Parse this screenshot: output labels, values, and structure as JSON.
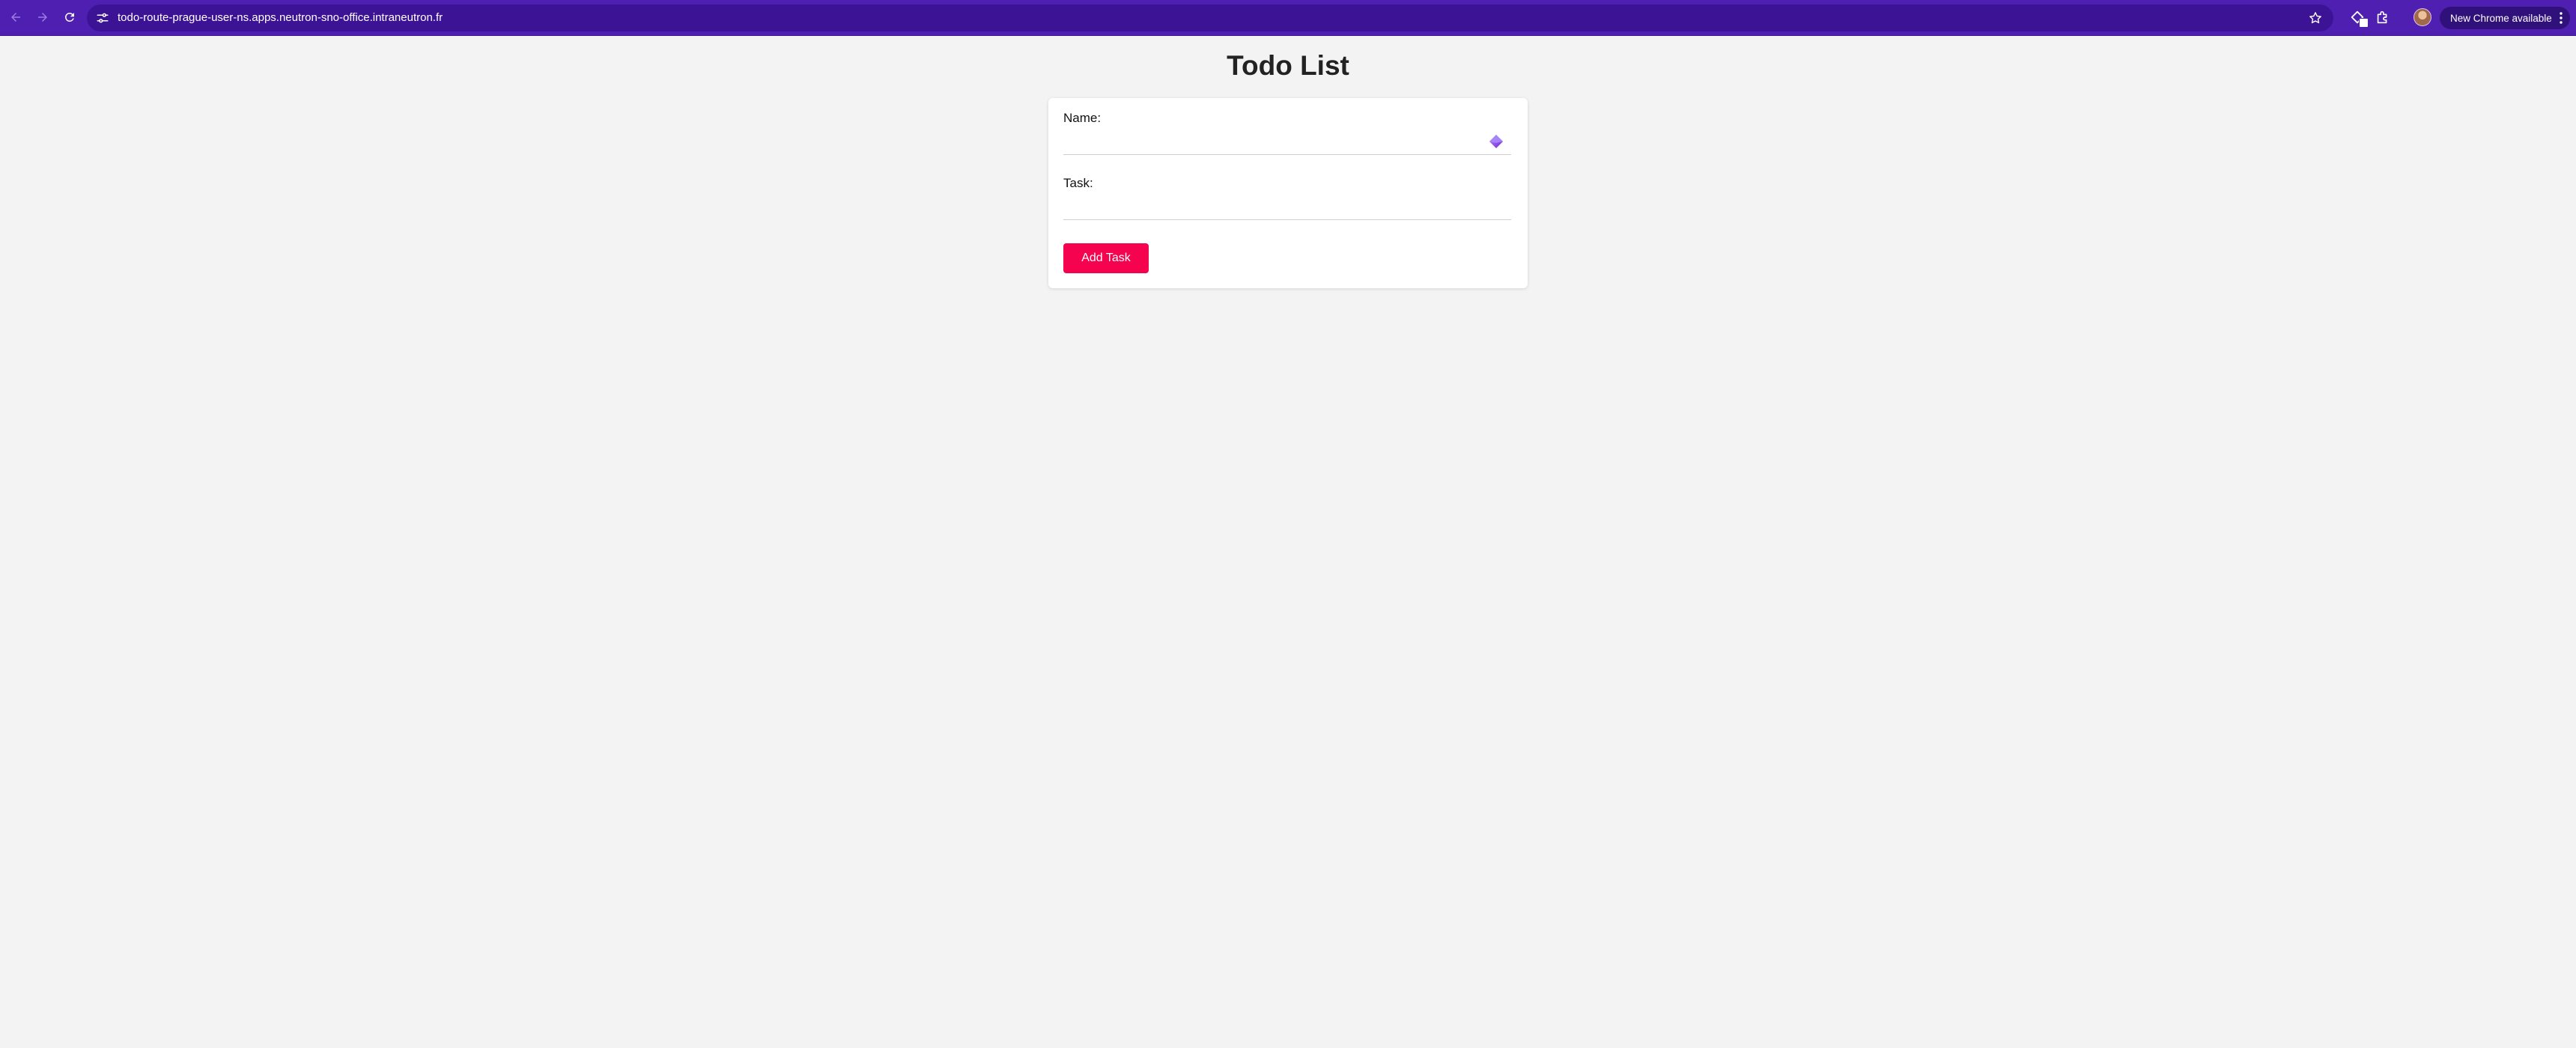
{
  "browser": {
    "url": "todo-route-prague-user-ns.apps.neutron-sno-office.intraneutron.fr",
    "update_pill_label": "New Chrome available",
    "accent_color": "#4f1fb2"
  },
  "icons": {
    "back": "arrow-left-icon",
    "forward": "arrow-right-icon",
    "reload": "reload-icon",
    "site_info": "tune-icon",
    "bookmark": "star-icon",
    "extension": "extension-icon",
    "puzzle": "puzzle-icon",
    "menu": "kebab-icon",
    "autofill": "autofill-gem-icon"
  },
  "page": {
    "title": "Todo List"
  },
  "form": {
    "name_label": "Name:",
    "name_value": "",
    "task_label": "Task:",
    "task_value": "",
    "submit_label": "Add Task",
    "submit_color": "#f5034f"
  }
}
